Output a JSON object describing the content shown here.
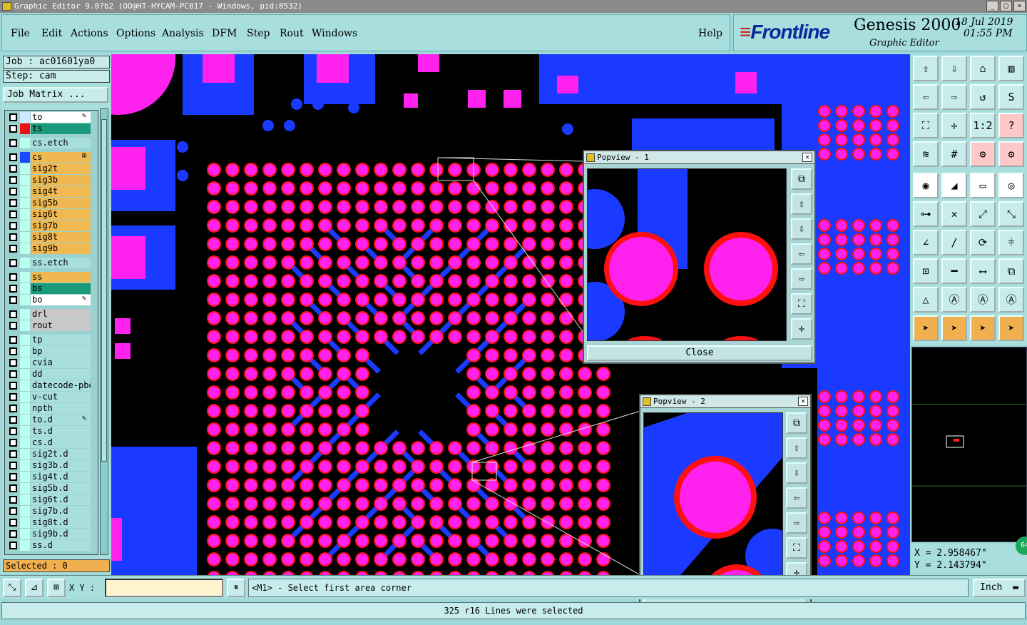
{
  "window": {
    "title": "Graphic Editor 9.0?b2 (OO@HT-HYCAM-PC017 - Windows, pid:8532)"
  },
  "menu": [
    "File",
    "Edit",
    "Actions",
    "Options",
    "Analysis",
    "DFM",
    "Step",
    "Rout",
    "Windows"
  ],
  "help": "Help",
  "brand": {
    "logo": "Frontline",
    "product": "Genesis 2000",
    "subtitle": "Graphic Editor",
    "date": "18 Jul 2019",
    "time": "01:55 PM"
  },
  "job": {
    "job_label": "Job : ac01601ya0",
    "step_label": "Step: cam",
    "matrix_button": "Job Matrix ..."
  },
  "layers": [
    {
      "name": "to",
      "swatch": "#cfe8ff",
      "label_bg": "#ffffff",
      "mark": "✎"
    },
    {
      "name": "ts",
      "swatch": "#ee1111",
      "label_bg": "#1a9a7a",
      "mark": ""
    },
    {
      "name": "cs.etch",
      "swatch": "#bfe",
      "label_bg": "#a8dede",
      "mark": ""
    },
    {
      "name": "cs",
      "swatch": "#1a4aff",
      "label_bg": "#f0b850",
      "mark": "⊞"
    },
    {
      "name": "sig2t",
      "swatch": "#bfe",
      "label_bg": "#f0b850",
      "mark": ""
    },
    {
      "name": "sig3b",
      "swatch": "#bfe",
      "label_bg": "#f0b850",
      "mark": ""
    },
    {
      "name": "sig4t",
      "swatch": "#bfe",
      "label_bg": "#f0b850",
      "mark": ""
    },
    {
      "name": "sig5b",
      "swatch": "#bfe",
      "label_bg": "#f0b850",
      "mark": ""
    },
    {
      "name": "sig6t",
      "swatch": "#bfe",
      "label_bg": "#f0b850",
      "mark": ""
    },
    {
      "name": "sig7b",
      "swatch": "#bfe",
      "label_bg": "#f0b850",
      "mark": ""
    },
    {
      "name": "sig8t",
      "swatch": "#bfe",
      "label_bg": "#f0b850",
      "mark": ""
    },
    {
      "name": "sig9b",
      "swatch": "#bfe",
      "label_bg": "#f0b850",
      "mark": ""
    },
    {
      "name": "ss.etch",
      "swatch": "#bfe",
      "label_bg": "#a8dede",
      "mark": ""
    },
    {
      "name": "ss",
      "swatch": "#bfe",
      "label_bg": "#f0b850",
      "mark": ""
    },
    {
      "name": "bs",
      "swatch": "#bfe",
      "label_bg": "#1a9a7a",
      "mark": ""
    },
    {
      "name": "bo",
      "swatch": "#bfe",
      "label_bg": "#ffffff",
      "mark": "✎"
    },
    {
      "name": "drl",
      "swatch": "#bfe",
      "label_bg": "#c8c8c8",
      "mark": ""
    },
    {
      "name": "rout",
      "swatch": "#bfe",
      "label_bg": "#c8c8c8",
      "mark": ""
    },
    {
      "name": "tp",
      "swatch": "#bfe",
      "label_bg": "#a8dede",
      "mark": ""
    },
    {
      "name": "bp",
      "swatch": "#bfe",
      "label_bg": "#a8dede",
      "mark": ""
    },
    {
      "name": "cvia",
      "swatch": "#bfe",
      "label_bg": "#a8dede",
      "mark": ""
    },
    {
      "name": "dd",
      "swatch": "#bfe",
      "label_bg": "#a8dede",
      "mark": ""
    },
    {
      "name": "datecode-pbo",
      "swatch": "#bfe",
      "label_bg": "#a8dede",
      "mark": ""
    },
    {
      "name": "v-cut",
      "swatch": "#bfe",
      "label_bg": "#a8dede",
      "mark": ""
    },
    {
      "name": "npth",
      "swatch": "#bfe",
      "label_bg": "#a8dede",
      "mark": ""
    },
    {
      "name": "to.d",
      "swatch": "#bfe",
      "label_bg": "#a8dede",
      "mark": "✎"
    },
    {
      "name": "ts.d",
      "swatch": "#bfe",
      "label_bg": "#a8dede",
      "mark": ""
    },
    {
      "name": "cs.d",
      "swatch": "#bfe",
      "label_bg": "#a8dede",
      "mark": ""
    },
    {
      "name": "sig2t.d",
      "swatch": "#bfe",
      "label_bg": "#a8dede",
      "mark": ""
    },
    {
      "name": "sig3b.d",
      "swatch": "#bfe",
      "label_bg": "#a8dede",
      "mark": ""
    },
    {
      "name": "sig4t.d",
      "swatch": "#bfe",
      "label_bg": "#a8dede",
      "mark": ""
    },
    {
      "name": "sig5b.d",
      "swatch": "#bfe",
      "label_bg": "#a8dede",
      "mark": ""
    },
    {
      "name": "sig6t.d",
      "swatch": "#bfe",
      "label_bg": "#a8dede",
      "mark": ""
    },
    {
      "name": "sig7b.d",
      "swatch": "#bfe",
      "label_bg": "#a8dede",
      "mark": ""
    },
    {
      "name": "sig8t.d",
      "swatch": "#bfe",
      "label_bg": "#a8dede",
      "mark": ""
    },
    {
      "name": "sig9b.d",
      "swatch": "#bfe",
      "label_bg": "#a8dede",
      "mark": ""
    },
    {
      "name": "ss.d",
      "swatch": "#bfe",
      "label_bg": "#a8dede",
      "mark": ""
    }
  ],
  "selected": "Selected : 0",
  "popview1": {
    "title": "Popview - 1",
    "close": "Close"
  },
  "popview2": {
    "title": "Popview - 2",
    "close": "Close"
  },
  "coords": {
    "x": "X = 2.958467\"",
    "y": "Y = 2.143794\""
  },
  "zoom_badge": "64",
  "xy_label": "X Y :",
  "prompt": "<M1> - Select first area corner",
  "units": "Inch",
  "status": "325 r16 Lines were selected",
  "colors": {
    "copper": "#1a3aff",
    "pad": "#ff22ee",
    "mask": "#ff1010",
    "background": "#000000"
  }
}
